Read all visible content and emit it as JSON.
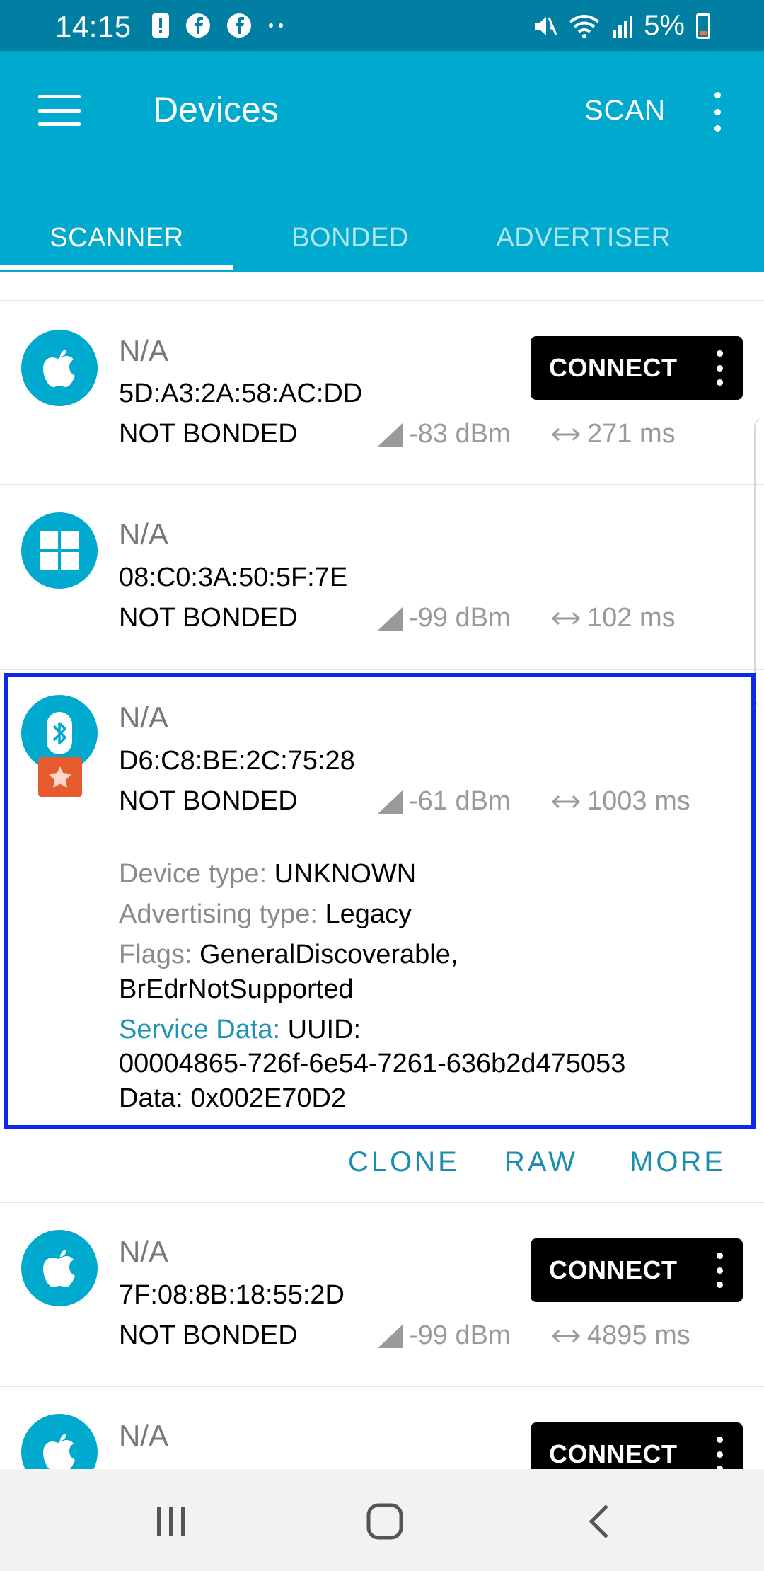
{
  "status_bar": {
    "time": "14:15",
    "battery": "5%"
  },
  "app_bar": {
    "title": "Devices",
    "scan_label": "SCAN"
  },
  "tabs": [
    {
      "label": "SCANNER",
      "active": true
    },
    {
      "label": "BONDED",
      "active": false
    },
    {
      "label": "ADVERTISER",
      "active": false
    }
  ],
  "devices": [
    {
      "icon": "apple-icon",
      "name": "N/A",
      "address": "5D:A3:2A:58:AC:DD",
      "bond_state": "NOT BONDED",
      "rssi": "-83 dBm",
      "interval": "271 ms",
      "connect_label": "CONNECT"
    },
    {
      "icon": "windows-icon",
      "name": "N/A",
      "address": "08:C0:3A:50:5F:7E",
      "bond_state": "NOT BONDED",
      "rssi": "-99 dBm",
      "interval": "102 ms"
    },
    {
      "icon": "bluetooth-icon",
      "name": "N/A",
      "address": "D6:C8:BE:2C:75:28",
      "bond_state": "NOT BONDED",
      "rssi": "-61 dBm",
      "interval": "1003 ms",
      "details": {
        "device_type_label": "Device type:",
        "device_type": "UNKNOWN",
        "adv_type_label": "Advertising type:",
        "adv_type": "Legacy",
        "flags_label": "Flags:",
        "flags_line1": "GeneralDiscoverable,",
        "flags_line2": "BrEdrNotSupported",
        "service_data_label": "Service Data:",
        "service_uuid_label": "UUID:",
        "service_uuid": "00004865-726f-6e54-7261-636b2d475053",
        "service_data": "Data: 0x002E70D2"
      },
      "actions": {
        "clone": "CLONE",
        "raw": "RAW",
        "more": "MORE"
      }
    },
    {
      "icon": "apple-icon",
      "name": "N/A",
      "address": "7F:08:8B:18:55:2D",
      "bond_state": "NOT BONDED",
      "rssi": "-99 dBm",
      "interval": "4895 ms",
      "connect_label": "CONNECT"
    },
    {
      "icon": "apple-icon",
      "name": "N/A",
      "connect_label": "CONNECT"
    }
  ],
  "colors": {
    "primary": "#00a9ce",
    "primary_dark": "#007fa3",
    "selection": "#0d29e8",
    "badge": "#e55b2d",
    "link": "#1b8db0"
  }
}
